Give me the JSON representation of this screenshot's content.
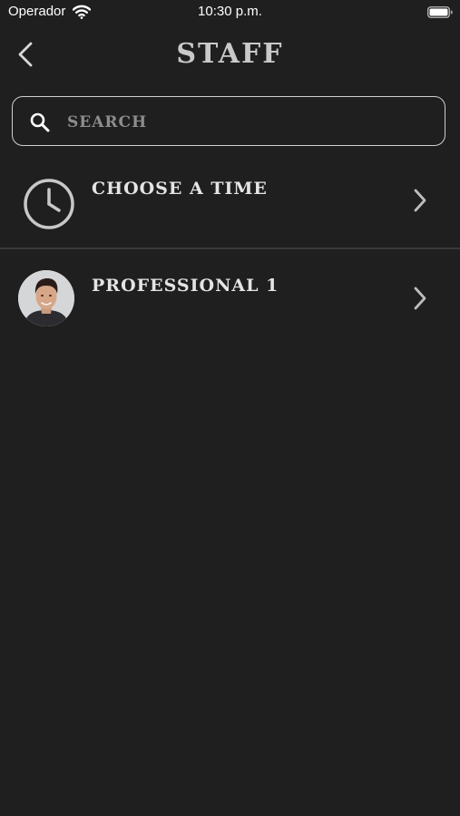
{
  "status_bar": {
    "carrier": "Operador",
    "time": "10:30 p.m."
  },
  "nav": {
    "title": "STAFF",
    "back_icon": "chevron-left-icon"
  },
  "search": {
    "placeholder": "SEARCH",
    "value": "",
    "icon": "search-icon"
  },
  "list": {
    "items": [
      {
        "label": "CHOOSE A TIME",
        "icon": "clock-icon"
      },
      {
        "label": "PROFESSIONAL 1",
        "icon": "avatar"
      }
    ]
  },
  "colors": {
    "background": "#1f1f1f",
    "text": "#e4e4e4",
    "title": "#c9c9c9",
    "border": "#cfcfcf",
    "divider": "#3a3a3a",
    "placeholder": "#8d8d8d"
  }
}
